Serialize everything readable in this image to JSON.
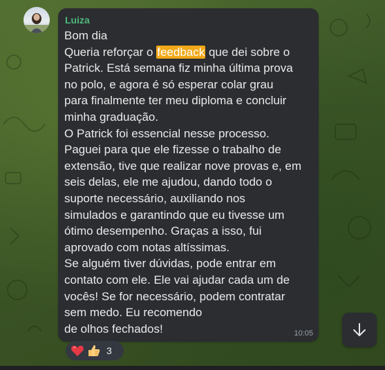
{
  "message": {
    "sender": "Luiza",
    "lines": [
      {
        "text": "Bom dia"
      },
      {
        "before": "Queria reforçar o ",
        "highlight": "feedback",
        "after": " que dei sobre o"
      },
      {
        "text": "Patrick. Está semana fiz minha última prova"
      },
      {
        "text": "no polo, e agora é só esperar colar grau"
      },
      {
        "text": "para finalmente ter meu diploma e concluir"
      },
      {
        "text": "minha graduação."
      },
      {
        "text": "O Patrick foi essencial nesse processo."
      },
      {
        "text": "Paguei para que ele fizesse o trabalho de"
      },
      {
        "text": "extensão, tive que realizar nove provas e, em"
      },
      {
        "text": "seis delas, ele me ajudou, dando todo o"
      },
      {
        "text": "suporte necessário, auxiliando nos"
      },
      {
        "text": "simulados e garantindo que eu tivesse um"
      },
      {
        "text": "ótimo desempenho. Graças a isso, fui"
      },
      {
        "text": "aprovado com notas altíssimas."
      },
      {
        "text": "Se alguém tiver dúvidas, pode entrar em"
      },
      {
        "text": "contato com ele. Ele vai ajudar cada um de"
      },
      {
        "text": "vocês! Se for necessário, podem contratar"
      },
      {
        "text": "sem medo. Eu recomendo"
      },
      {
        "text": "de olhos fechados!"
      }
    ],
    "time": "10:05"
  },
  "reactions": {
    "icons": [
      "red-heart-icon",
      "thumbs-up-icon"
    ],
    "count": "3"
  },
  "colors": {
    "sender": "#4fb87c",
    "highlight": "#f2a818",
    "bubble": "#2b2d31",
    "text": "#eaeaea"
  },
  "scroll_button_icon": "arrow-down-icon"
}
